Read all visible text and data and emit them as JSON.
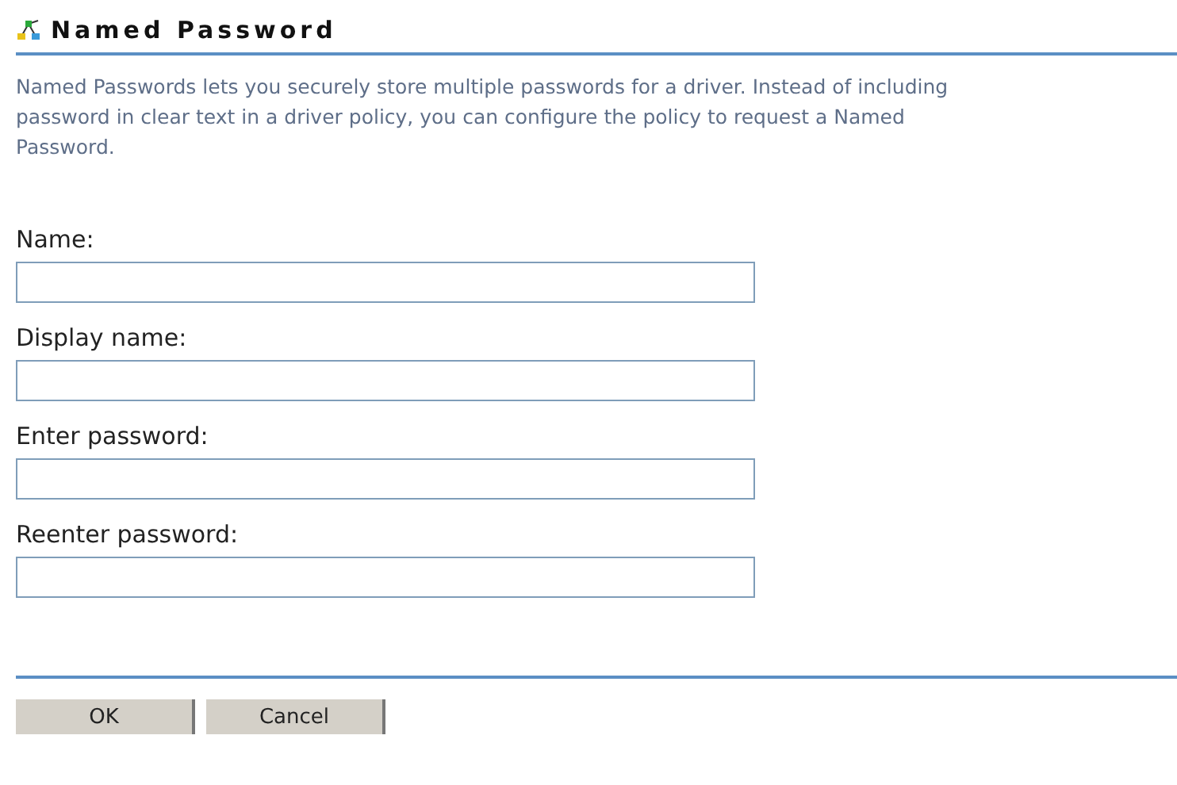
{
  "title": "Named Password",
  "description": "Named Passwords lets you securely store multiple passwords for a driver. Instead of including\npassword in clear text in a driver policy, you can configure the policy to request a Named\nPassword.",
  "fields": [
    {
      "label": "Name:"
    },
    {
      "label": "Display name:"
    },
    {
      "label": "Enter password:"
    },
    {
      "label": "Reenter password:"
    }
  ],
  "buttons": [
    "OK",
    "Cancel"
  ]
}
